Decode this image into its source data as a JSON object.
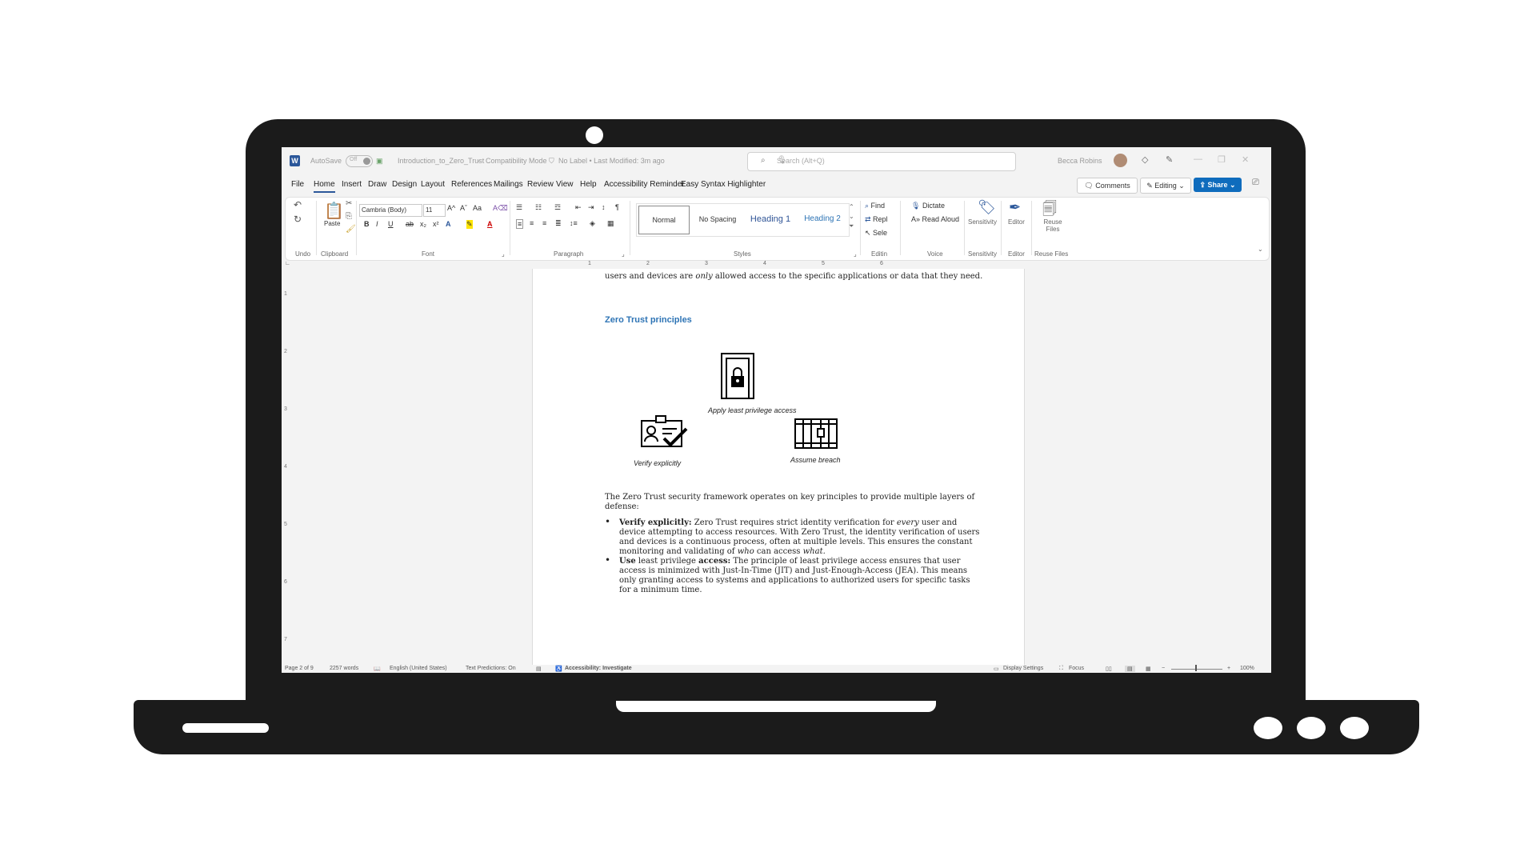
{
  "titlebar": {
    "autosave_label": "AutoSave",
    "autosave_state": "Off",
    "document_name": "Introduction_to_Zero_Trust",
    "mode": "Compatibility Mode",
    "label_status": "No Label • Last Modified: 3m ago",
    "search_placeholder": "Search (Alt+Q)",
    "user_name": "Becca Robins"
  },
  "menu": {
    "file": "File",
    "home": "Home",
    "insert": "Insert",
    "draw": "Draw",
    "design": "Design",
    "layout": "Layout",
    "references": "References",
    "mailings": "Mailings",
    "review": "Review",
    "view": "View",
    "help": "Help",
    "accessibility": "Accessibility Reminder",
    "syntax": "Easy Syntax Highlighter",
    "comments": "Comments",
    "editing": "Editing",
    "share": "Share"
  },
  "ribbon": {
    "undo_group": "Undo",
    "paste": "Paste",
    "clipboard_group": "Clipboard",
    "font_name": "Cambria (Body)",
    "font_size": "11",
    "font_group": "Font",
    "paragraph_group": "Paragraph",
    "styles": [
      "Normal",
      "No Spacing",
      "Heading 1",
      "Heading 2"
    ],
    "styles_group": "Styles",
    "find": "Find",
    "replace": "Repl",
    "select": "Sele",
    "editing_group": "Editin",
    "dictate": "Dictate",
    "read_aloud": "Read Aloud",
    "voice_group": "Voice",
    "sensitivity": "Sensitivity",
    "sensitivity_group": "Sensitivity",
    "editor": "Editor",
    "editor_group": "Editor",
    "reuse_files": "Reuse Files",
    "reuse_group": "Reuse Files"
  },
  "document": {
    "line_top_a": "users and devices are",
    "line_top_b": "only",
    "line_top_c": "allowed access to the specific applications or data that they need.",
    "heading": "Zero Trust principles",
    "caption_lock": "Apply least privilege access",
    "caption_verify": "Verify explicitly",
    "caption_breach": "Assume breach",
    "intro_1": "The Zero Trust security framework operates on key principles to provide multiple layers of",
    "intro_2": "defense:",
    "b1_bold": "Verify explicitly:",
    "b1_l1a": "Zero Trust requires strict identity verification for",
    "b1_l1b": "every",
    "b1_l1c": "user and",
    "b1_l2": "device attempting to access resources. With Zero Trust, the identity verification of users",
    "b1_l3": "and devices is a continuous process, often at multiple levels. This ensures the constant",
    "b1_l4a": "monitoring and validating of",
    "b1_l4b": "who",
    "b1_l4c": "can access",
    "b1_l4d": "what.",
    "b2_bold1": "Use",
    "b2_mid": "least privilege",
    "b2_bold2": "access:",
    "b2_l1": "The principle of least privilege access ensures that user",
    "b2_l2": "access is minimized with Just-In-Time (JIT) and Just-Enough-Access (JEA). This means",
    "b2_l3": "only granting access to systems and applications to authorized users for specific tasks",
    "b2_l4": "for a minimum time."
  },
  "statusbar": {
    "page": "Page 2 of 9",
    "words": "2257 words",
    "language": "English (United States)",
    "predictions": "Text Predictions: On",
    "accessibility": "Accessibility: Investigate",
    "display": "Display Settings",
    "focus": "Focus",
    "zoom": "100%"
  },
  "colors": {
    "accent": "#2b579a",
    "heading": "#2e74b5",
    "share": "#0f6cbd",
    "frame": "#1b1b1b"
  }
}
